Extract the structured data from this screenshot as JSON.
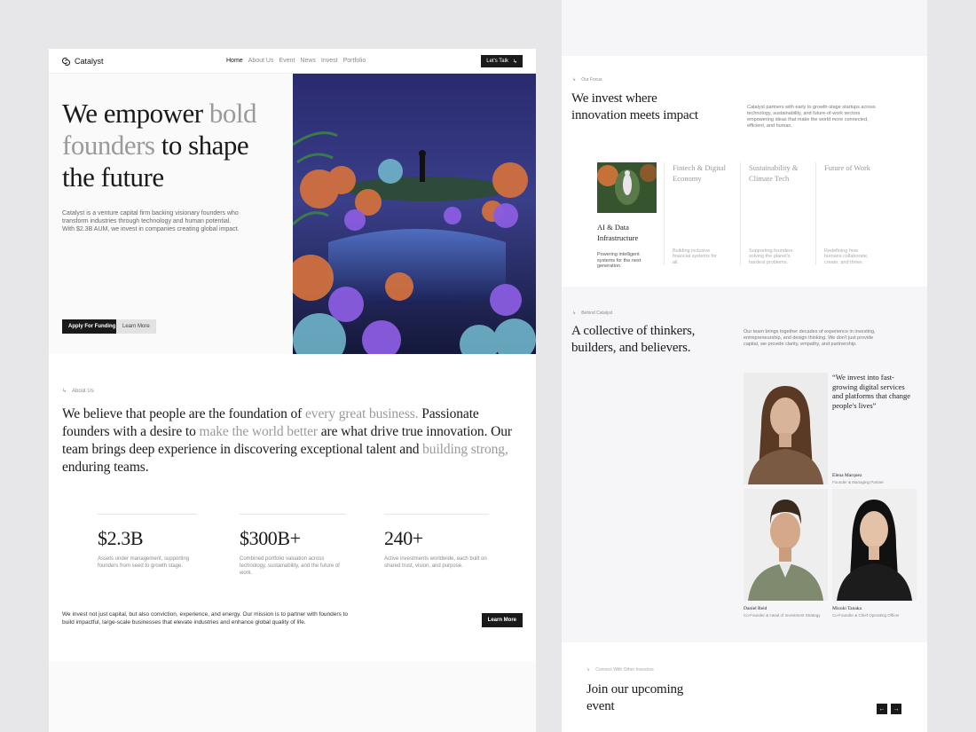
{
  "brand": "Catalyst",
  "nav": {
    "items": [
      "Home",
      "About Us",
      "Event",
      "News",
      "Invest",
      "Portfolio"
    ],
    "active": "Home",
    "cta": "Let's Talk"
  },
  "hero": {
    "title_part1": "We empower ",
    "title_part2": "bold founders",
    "title_part3": " to shape the future",
    "description": "Catalyst is a venture capital firm backing visionary founders who transform industries through technology and human potential. With $2.3B AUM, we invest in companies creating global impact.",
    "primary_button": "Apply For Funding",
    "secondary_button": "Learn More"
  },
  "about": {
    "kicker": "About Us",
    "t1": "We believe that people are the foundation of ",
    "h1": "every great business.",
    "t2": " Passionate founders with a desire to ",
    "h2": "make the world better",
    "t3": " are what drive true innovation. Our team brings deep experience in discovering exceptional talent and ",
    "h3": "building strong,",
    "t4": " enduring teams.",
    "stats": [
      {
        "value": "$2.3B",
        "desc": "Assets under management, supporting founders from seed to growth stage."
      },
      {
        "value": "$300B+",
        "desc": "Combined portfolio valuation across technology, sustainability, and the future of work."
      },
      {
        "value": "240+",
        "desc": "Active investments worldwide, each built on shared trust, vision, and purpose."
      }
    ],
    "mission": "We invest not just capital, but also conviction, experience, and energy. Our mission is to partner with founders to build impactful, large-scale businesses that elevate industries and enhance global quality of life.",
    "mission_button": "Learn More"
  },
  "focus": {
    "kicker": "Our Focus",
    "title": "We invest where innovation meets impact",
    "side": "Catalyst partners with early to growth-stage startups across technology, sustainability, and future-of-work sectors empowering ideas that make the world more connected, efficient, and human.",
    "sectors": [
      {
        "title": "AI & Data Infrastructure",
        "desc": "Powering intelligent systems for the next generation."
      },
      {
        "title": "Fintech & Digital Economy",
        "desc": "Building inclusive financial systems for all."
      },
      {
        "title": "Sustainability & Climate Tech",
        "desc": "Supporting founders solving the planet's hardest problems."
      },
      {
        "title": "Future of Work",
        "desc": "Redefining how humans collaborate, create, and thrive."
      }
    ]
  },
  "team": {
    "kicker": "Behind Catalyst",
    "title": "A collective of thinkers, builders, and believers.",
    "side": "Our team brings together decades of experience in investing, entrepreneurship, and design thinking. We don't just provide capital, we provide clarity, empathy, and partnership.",
    "quote": "“We invest into fast-growing digital services and platforms that change people's lives”",
    "members": [
      {
        "name": "Elena Marquez",
        "role": "Founder & Managing Partner"
      },
      {
        "name": "Daniel Reid",
        "role": "Co-Founder & Head of Investment Strategy"
      },
      {
        "name": "Mizuki Tanaka",
        "role": "Co-Founder & Chief Operating Officer"
      }
    ]
  },
  "event": {
    "kicker": "Connect With Other Investors",
    "title": "Join our upcoming event"
  },
  "colors": {
    "accent": "#1a1a1a",
    "muted": "#9a9a9a",
    "page": "#fafafb"
  }
}
